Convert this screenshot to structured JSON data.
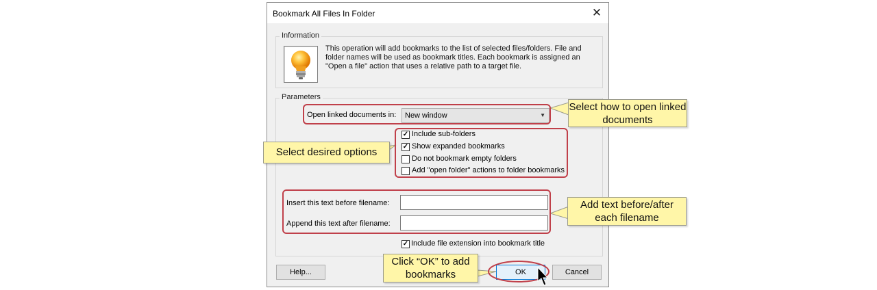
{
  "dialog": {
    "title": "Bookmark All Files In Folder",
    "close_glyph": "✕"
  },
  "information": {
    "legend": "Information",
    "text": "This operation will add bookmarks to the list of selected files/folders. File and folder names will be used as bookmark titles. Each bookmark is assigned an \"Open a file\" action that uses a relative path to a target file.",
    "icon": "lightbulb-icon"
  },
  "parameters": {
    "legend": "Parameters",
    "open_linked_label": "Open linked documents in:",
    "open_linked_value": "New window",
    "options": [
      {
        "label": "Include sub-folders",
        "checked": true
      },
      {
        "label": "Show expanded bookmarks",
        "checked": true
      },
      {
        "label": "Do not bookmark empty folders",
        "checked": false
      },
      {
        "label": "Add \"open folder\" actions to folder bookmarks",
        "checked": false
      }
    ],
    "before_label": "Insert this text before filename:",
    "before_value": "",
    "after_label": "Append this text after filename:",
    "after_value": "",
    "include_ext_label": "Include file extension into bookmark title",
    "include_ext_checked": true
  },
  "buttons": {
    "help": "Help...",
    "ok": "OK",
    "cancel": "Cancel"
  },
  "callouts": {
    "open_how": "Select how to open linked documents",
    "options": "Select desired options",
    "text": "Add text before/after each filename",
    "ok": "Click “OK” to add bookmarks"
  },
  "colors": {
    "highlight": "#c0404a",
    "callout_bg": "#fff6a8"
  }
}
